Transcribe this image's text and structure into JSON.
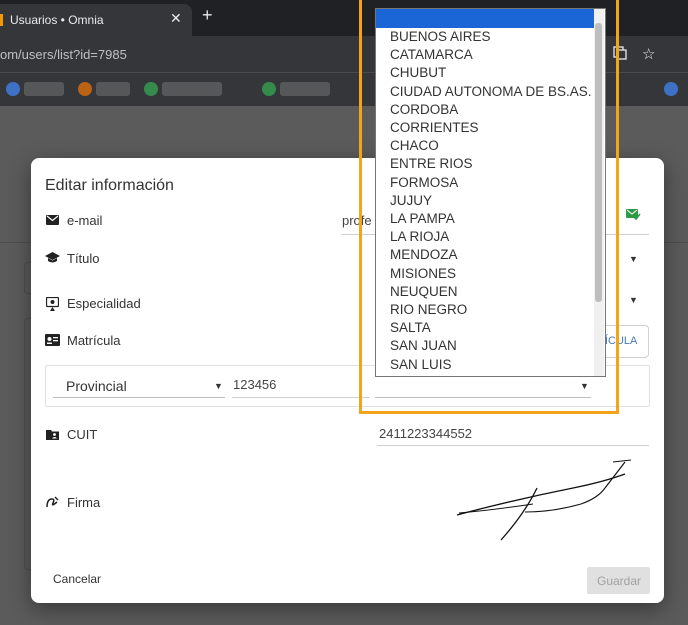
{
  "browser": {
    "tab_title": "Usuarios • Omnia",
    "tab_close_glyph": "✕",
    "new_tab_glyph": "+",
    "url_text": "om/users/list?id=7985"
  },
  "dialog": {
    "title": "Editar información",
    "email": {
      "label": "e-mail",
      "value_partial": "profe"
    },
    "titulo": {
      "label": "Título"
    },
    "especialidad": {
      "label": "Especialidad"
    },
    "matricula": {
      "label": "Matrícula",
      "type_value": "Provincial",
      "number_value": "123456",
      "add_button_partial": "RÍCULA"
    },
    "cuit": {
      "label": "CUIT",
      "value": "2411223344552"
    },
    "firma": {
      "label": "Firma"
    },
    "cancel_label": "Cancelar",
    "save_label": "Guardar"
  },
  "province_dropdown": {
    "selected_index": 0,
    "options": [
      "",
      "BUENOS AIRES",
      "CATAMARCA",
      "CHUBUT",
      "CIUDAD AUTONOMA DE BS.AS.",
      "CORDOBA",
      "CORRIENTES",
      "CHACO",
      "ENTRE RIOS",
      "FORMOSA",
      "JUJUY",
      "LA PAMPA",
      "LA RIOJA",
      "MENDOZA",
      "MISIONES",
      "NEUQUEN",
      "RIO NEGRO",
      "SALTA",
      "SAN JUAN",
      "SAN LUIS"
    ]
  },
  "colors": {
    "dropdown_highlight": "#1a66d6",
    "annotation_outline": "#f5a31a",
    "button_link_blue": "#4a7ab7",
    "valid_icon_green": "#2e9a47"
  }
}
